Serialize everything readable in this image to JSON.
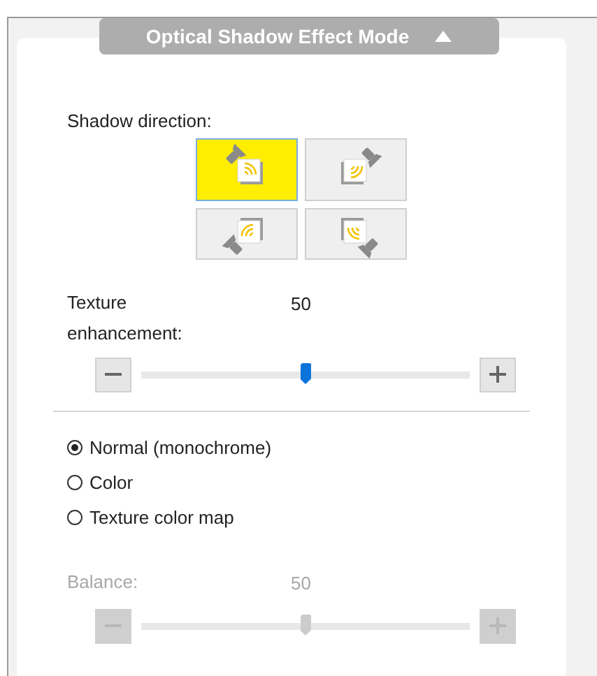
{
  "panel": {
    "title": "Optical Shadow Effect Mode",
    "expanded": true
  },
  "shadow_direction": {
    "label": "Shadow direction:",
    "options": [
      {
        "kind": "top-left",
        "selected": true
      },
      {
        "kind": "top-right",
        "selected": false
      },
      {
        "kind": "bottom-left",
        "selected": false
      },
      {
        "kind": "bottom-right",
        "selected": false
      }
    ]
  },
  "sliders": [
    {
      "label": "Texture enhancement:",
      "reading": "50",
      "level": 0.5,
      "disabled": false
    }
  ],
  "modes": [
    {
      "label": "Normal (monochrome)",
      "selected": true
    },
    {
      "label": "Color",
      "selected": false
    },
    {
      "label": "Texture color map",
      "selected": false
    }
  ],
  "balance": {
    "label": "Balance:",
    "reading": "50",
    "level": 0.5,
    "disabled": true
  }
}
